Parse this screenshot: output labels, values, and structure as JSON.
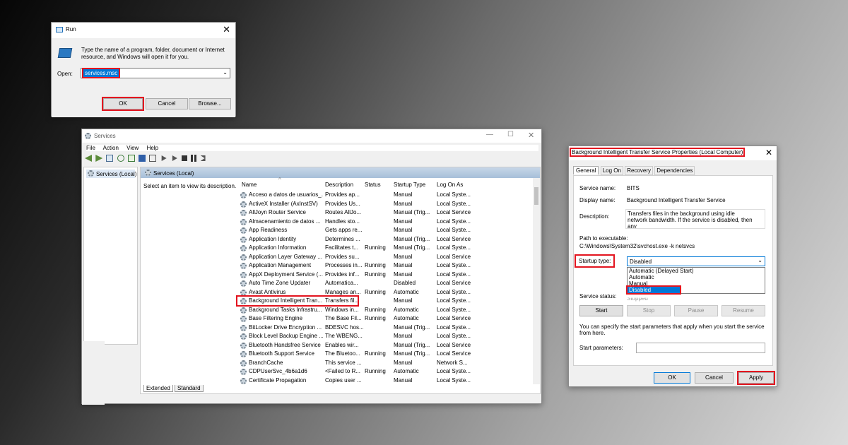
{
  "run": {
    "title": "Run",
    "desc": "Type the name of a program, folder, document or Internet resource, and Windows will open it for you.",
    "open_label": "Open:",
    "open_value": "services.msc",
    "ok": "OK",
    "cancel": "Cancel",
    "browse": "Browse..."
  },
  "services": {
    "title": "Services",
    "menu": [
      "File",
      "Action",
      "View",
      "Help"
    ],
    "tree_item": "Services (Local)",
    "header_title": "Services (Local)",
    "select_hint": "Select an item to view its description.",
    "columns": [
      "Name",
      "Description",
      "Status",
      "Startup Type",
      "Log On As"
    ],
    "rows": [
      [
        "Acceso a datos de usuarios_...",
        "Provides ap...",
        "",
        "Manual",
        "Local Syste..."
      ],
      [
        "ActiveX Installer (AxInstSV)",
        "Provides Us...",
        "",
        "Manual",
        "Local Syste..."
      ],
      [
        "AllJoyn Router Service",
        "Routes AllJo...",
        "",
        "Manual (Trig...",
        "Local Service"
      ],
      [
        "Almacenamiento de datos ...",
        "Handles sto...",
        "",
        "Manual",
        "Local Syste..."
      ],
      [
        "App Readiness",
        "Gets apps re...",
        "",
        "Manual",
        "Local Syste..."
      ],
      [
        "Application Identity",
        "Determines ...",
        "",
        "Manual (Trig...",
        "Local Service"
      ],
      [
        "Application Information",
        "Facilitates t...",
        "Running",
        "Manual (Trig...",
        "Local Syste..."
      ],
      [
        "Application Layer Gateway ...",
        "Provides su...",
        "",
        "Manual",
        "Local Service"
      ],
      [
        "Application Management",
        "Processes in...",
        "Running",
        "Manual",
        "Local Syste..."
      ],
      [
        "AppX Deployment Service (...",
        "Provides inf...",
        "Running",
        "Manual",
        "Local Syste..."
      ],
      [
        "Auto Time Zone Updater",
        "Automatica...",
        "",
        "Disabled",
        "Local Service"
      ],
      [
        "Avast Antivirus",
        "Manages an...",
        "Running",
        "Automatic",
        "Local Syste..."
      ],
      [
        "Background Intelligent Tran...",
        "Transfers fil...",
        "",
        "Manual",
        "Local Syste..."
      ],
      [
        "Background Tasks Infrastru...",
        "Windows in...",
        "Running",
        "Automatic",
        "Local Syste..."
      ],
      [
        "Base Filtering Engine",
        "The Base Fil...",
        "Running",
        "Automatic",
        "Local Service"
      ],
      [
        "BitLocker Drive Encryption ...",
        "BDESVC hos...",
        "",
        "Manual (Trig...",
        "Local Syste..."
      ],
      [
        "Block Level Backup Engine ...",
        "The WBENG...",
        "",
        "Manual",
        "Local Syste..."
      ],
      [
        "Bluetooth Handsfree Service",
        "Enables wir...",
        "",
        "Manual (Trig...",
        "Local Service"
      ],
      [
        "Bluetooth Support Service",
        "The Bluetoo...",
        "Running",
        "Manual (Trig...",
        "Local Service"
      ],
      [
        "BranchCache",
        "This service ...",
        "",
        "Manual",
        "Network S..."
      ],
      [
        "CDPUserSvc_4b6a1d6",
        "<Failed to R...",
        "Running",
        "Automatic",
        "Local Syste..."
      ],
      [
        "Certificate Propagation",
        "Copies user ...",
        "",
        "Manual",
        "Local Syste..."
      ]
    ],
    "tabs": [
      "Extended",
      "Standard"
    ]
  },
  "props": {
    "title": "Background Intelligent Transfer Service Properties (Local Computer)",
    "tabs": [
      "General",
      "Log On",
      "Recovery",
      "Dependencies"
    ],
    "service_name_label": "Service name:",
    "service_name": "BITS",
    "display_name_label": "Display name:",
    "display_name": "Background Intelligent Transfer Service",
    "description_label": "Description:",
    "description": "Transfers files in the background using idle network bandwidth. If the service is disabled, then any",
    "path_label": "Path to executable:",
    "path": "C:\\Windows\\System32\\svchost.exe -k netsvcs",
    "startup_label": "Startup type:",
    "startup_value": "Disabled",
    "options": [
      "Automatic (Delayed Start)",
      "Automatic",
      "Manual",
      "Disabled"
    ],
    "status_label": "Service status:",
    "status_value": "Stopped",
    "start": "Start",
    "stop": "Stop",
    "pause": "Pause",
    "resume": "Resume",
    "hint": "You can specify the start parameters that apply when you start the service from here.",
    "params_label": "Start parameters:",
    "ok": "OK",
    "cancel": "Cancel",
    "apply": "Apply"
  }
}
